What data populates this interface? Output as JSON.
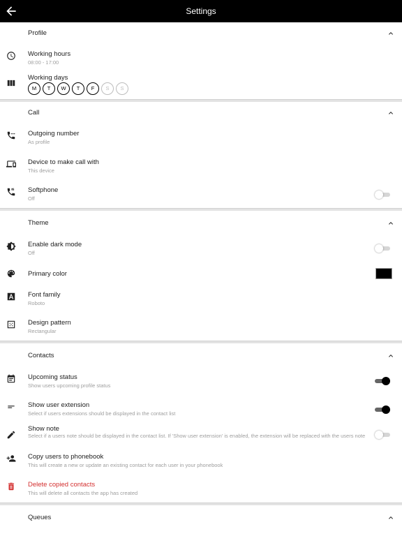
{
  "appbar": {
    "title": "Settings",
    "back_icon": "arrow-back-icon"
  },
  "profile": {
    "header": "Profile",
    "working_hours": {
      "title": "Working hours",
      "sub": "08:00 - 17:00"
    },
    "working_days": {
      "title": "Working days",
      "days": [
        {
          "label": "M",
          "active": true
        },
        {
          "label": "T",
          "active": true
        },
        {
          "label": "W",
          "active": true
        },
        {
          "label": "T",
          "active": true
        },
        {
          "label": "F",
          "active": true
        },
        {
          "label": "S",
          "active": false
        },
        {
          "label": "S",
          "active": false
        }
      ]
    }
  },
  "call": {
    "header": "Call",
    "outgoing": {
      "title": "Outgoing number",
      "sub": "As profile"
    },
    "device": {
      "title": "Device to make call with",
      "sub": "This device"
    },
    "softphone": {
      "title": "Softphone",
      "sub": "Off",
      "enabled": false
    }
  },
  "theme": {
    "header": "Theme",
    "dark_mode": {
      "title": "Enable dark mode",
      "sub": "Off",
      "enabled": false
    },
    "primary_color": {
      "title": "Primary color",
      "value": "#000000"
    },
    "font_family": {
      "title": "Font family",
      "sub": "Roboto"
    },
    "design_pattern": {
      "title": "Design pattern",
      "sub": "Rectangular"
    }
  },
  "contacts": {
    "header": "Contacts",
    "upcoming": {
      "title": "Upcoming status",
      "sub": "Show users upcoming profile status",
      "enabled": true
    },
    "extension": {
      "title": "Show user extension",
      "sub": "Select if users extensions should be displayed in the contact list",
      "enabled": true
    },
    "note": {
      "title": "Show note",
      "sub": "Select if a users note should be displayed in the contact list. If 'Show user extension' is enabled, the extension will be replaced with the users note",
      "enabled": false
    },
    "copy": {
      "title": "Copy users to phonebook",
      "sub": "This will create a new or update an existing contact for each user in your phonebook"
    },
    "delete": {
      "title": "Delete copied contacts",
      "sub": "This will delete all contacts the app has created"
    }
  },
  "queues": {
    "header": "Queues"
  },
  "colors": {
    "appbar": "#000000",
    "danger": "#d32f2f",
    "secondary_text": "#9e9e9e"
  }
}
